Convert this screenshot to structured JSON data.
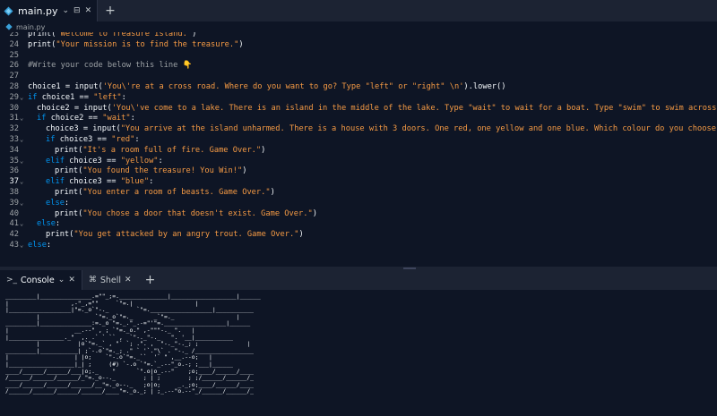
{
  "tabs": [
    {
      "label": "main.py",
      "active": true
    }
  ],
  "breadcrumb": {
    "file": "main.py"
  },
  "editor": {
    "active_line": 37,
    "lines": [
      {
        "n": "23",
        "fold": false,
        "indent": 0,
        "tokens": [
          [
            "n",
            "print(\""
          ],
          [
            "s",
            "Welcome to Treasure Island."
          ],
          [
            "n",
            "\")"
          ]
        ]
      },
      {
        "n": "24",
        "fold": false,
        "indent": 0,
        "tokens": [
          [
            "n",
            "print("
          ],
          [
            "s",
            "\"Your mission is to find the treasure.\""
          ],
          [
            "n",
            ")"
          ]
        ]
      },
      {
        "n": "25",
        "fold": false,
        "indent": 0,
        "tokens": []
      },
      {
        "n": "26",
        "fold": false,
        "indent": 0,
        "tokens": [
          [
            "c",
            "#Write your code below this line 👇"
          ]
        ]
      },
      {
        "n": "27",
        "fold": false,
        "indent": 0,
        "tokens": []
      },
      {
        "n": "28",
        "fold": false,
        "indent": 0,
        "tokens": [
          [
            "n",
            "choice1 = input("
          ],
          [
            "s",
            "'You\\'re at a cross road. Where do you want to go? Type \"left\" or \"right\" \\n'"
          ],
          [
            "n",
            ").lower()"
          ]
        ]
      },
      {
        "n": "29",
        "fold": true,
        "indent": 0,
        "tokens": [
          [
            "k",
            "if"
          ],
          [
            "n",
            " choice1 == "
          ],
          [
            "s",
            "\"left\""
          ],
          [
            "n",
            ":"
          ]
        ]
      },
      {
        "n": "30",
        "fold": false,
        "indent": 1,
        "tokens": [
          [
            "n",
            "choice2 = input("
          ],
          [
            "s",
            "'You\\'ve come to a lake. There is an island in the middle of the lake. Type \"wait\" to wait for a boat. Type \"swim\" to swim across. \\n'"
          ],
          [
            "n",
            ").lower()"
          ]
        ]
      },
      {
        "n": "31",
        "fold": true,
        "indent": 1,
        "tokens": [
          [
            "k",
            "if"
          ],
          [
            "n",
            " choice2 == "
          ],
          [
            "s",
            "\"wait\""
          ],
          [
            "n",
            ":"
          ]
        ]
      },
      {
        "n": "32",
        "fold": false,
        "indent": 2,
        "tokens": [
          [
            "n",
            "choice3 = input("
          ],
          [
            "s",
            "\"You arrive at the island unharmed. There is a house with 3 doors. One red, one yellow and one blue. Which colour do you choose? \\n\""
          ],
          [
            "n",
            ").lower()"
          ]
        ]
      },
      {
        "n": "33",
        "fold": true,
        "indent": 2,
        "tokens": [
          [
            "k",
            "if"
          ],
          [
            "n",
            " choice3 == "
          ],
          [
            "s",
            "\"red\""
          ],
          [
            "n",
            ":"
          ]
        ]
      },
      {
        "n": "34",
        "fold": false,
        "indent": 3,
        "tokens": [
          [
            "n",
            "print("
          ],
          [
            "s",
            "\"It's a room full of fire. Game Over.\""
          ],
          [
            "n",
            ")"
          ]
        ]
      },
      {
        "n": "35",
        "fold": true,
        "indent": 2,
        "tokens": [
          [
            "k",
            "elif"
          ],
          [
            "n",
            " choice3 == "
          ],
          [
            "s",
            "\"yellow\""
          ],
          [
            "n",
            ":"
          ]
        ]
      },
      {
        "n": "36",
        "fold": false,
        "indent": 3,
        "tokens": [
          [
            "n",
            "print("
          ],
          [
            "s",
            "\"You found the treasure! You Win!\""
          ],
          [
            "n",
            ")"
          ]
        ]
      },
      {
        "n": "37",
        "fold": true,
        "indent": 2,
        "tokens": [
          [
            "k",
            "elif"
          ],
          [
            "n",
            " choice3 == "
          ],
          [
            "s",
            "\"blue\""
          ],
          [
            "n",
            ":"
          ]
        ]
      },
      {
        "n": "38",
        "fold": false,
        "indent": 3,
        "tokens": [
          [
            "n",
            "print("
          ],
          [
            "s",
            "\"You enter a room of beasts. Game Over.\""
          ],
          [
            "n",
            ")"
          ]
        ]
      },
      {
        "n": "39",
        "fold": true,
        "indent": 2,
        "tokens": [
          [
            "k",
            "else"
          ],
          [
            "n",
            ":"
          ]
        ]
      },
      {
        "n": "40",
        "fold": false,
        "indent": 3,
        "tokens": [
          [
            "n",
            "print("
          ],
          [
            "s",
            "\"You chose a door that doesn't exist. Game Over.\""
          ],
          [
            "n",
            ")"
          ]
        ]
      },
      {
        "n": "41",
        "fold": true,
        "indent": 1,
        "tokens": [
          [
            "k",
            "else"
          ],
          [
            "n",
            ":"
          ]
        ]
      },
      {
        "n": "42",
        "fold": false,
        "indent": 2,
        "tokens": [
          [
            "n",
            "print("
          ],
          [
            "s",
            "\"You get attacked by an angry trout. Game Over.\""
          ],
          [
            "n",
            ")"
          ]
        ]
      },
      {
        "n": "43",
        "fold": true,
        "indent": 0,
        "tokens": [
          [
            "k",
            "else"
          ],
          [
            "n",
            ":"
          ]
        ]
      }
    ]
  },
  "console_tabs": [
    {
      "label": "Console",
      "active": true,
      "icon": "terminal-icon"
    },
    {
      "label": "Shell",
      "active": false,
      "icon": "shell-icon"
    }
  ],
  "console_output": "_________|_______________.=\"\"_;=.______________|___________________|______\n|                  ,-\"_,=\"\"     `\"=.|                  |\n|__________________|\"=._o`\"-._        `\"=.__________________|___________\n         |                `\"=._o`\"=._      _`\"=._                  |\n_________|_______________:=._o \"=._.\"_.-=\"'\"=.__________________|______\n|                   __.--\" , ; `\"=._o.\" ,-\"\"\"-._ \".   |\n|________________._\"  ,. .` ` `` ,  `\"-._\"-._   \". '__|___________\n         |           |o`\"=._` , \"` `; .\". ,  \"-._\"-._; ;              |\n_________|___________| ;`-.o`\"=._; .\" ` '`.\"\\` . \"-._ /_________________\n|                   | |o;    `\"-.o`\"=._``  '` \" ,__.--o;   |\n|___________________|_| ;     (#) `-.o `\"=.`_.--\"_o.-; ;___|______\n____/______/______/___|o;._    \"      `\".o|o_.--\"    ;o;____/______/____\n/______/______/______/_\"=._o--._        ; | ;        ; ;/______/______/_\n____/______/______/______/__\"=._o--._   ;o|o;     _._;o;____/______/____\n/______/______/______/______/____\"=._o._; | ;_.--\"o.--\"_/______/______/_"
}
